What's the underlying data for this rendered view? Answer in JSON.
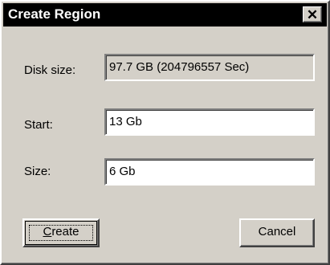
{
  "window": {
    "title": "Create Region",
    "close_glyph": "✕"
  },
  "fields": {
    "disk_size": {
      "label": "Disk size:",
      "value": "97.7 GB (204796557 Sec)"
    },
    "start": {
      "label": "Start:",
      "value": "13 Gb"
    },
    "size": {
      "label": "Size:",
      "value": "6 Gb"
    }
  },
  "buttons": {
    "create": {
      "mnemonic": "C",
      "rest": "reate"
    },
    "cancel": {
      "label": "Cancel"
    }
  }
}
